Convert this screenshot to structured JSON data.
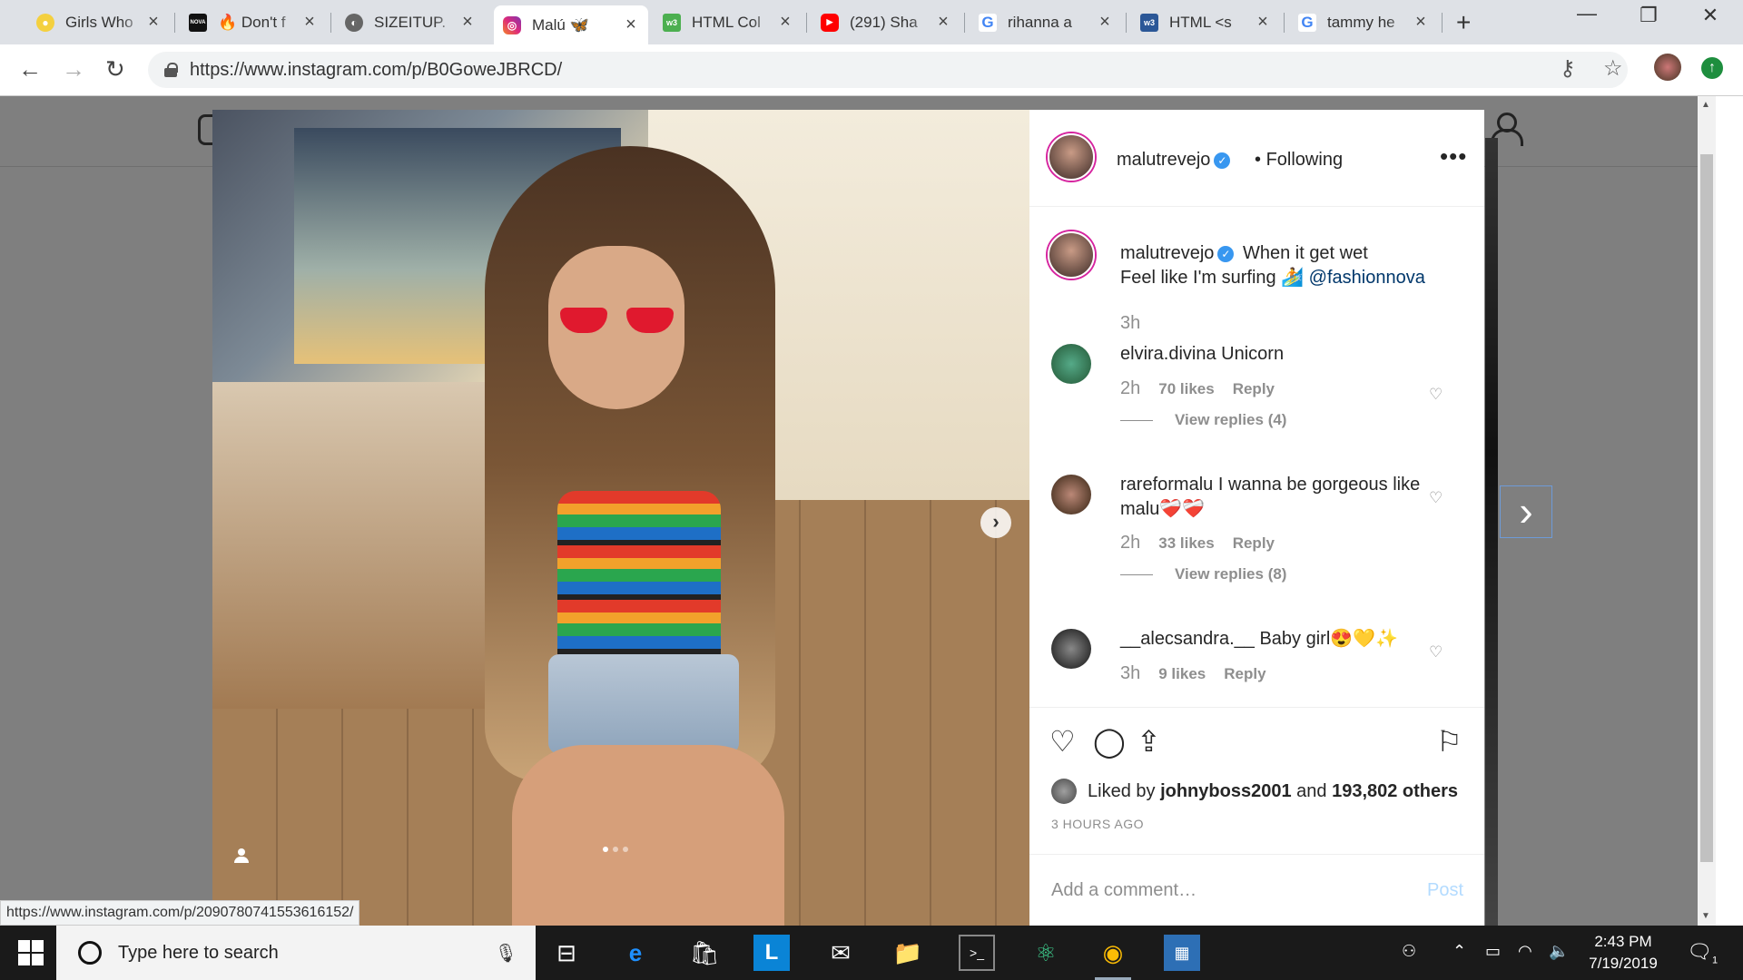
{
  "browser": {
    "tabs": [
      {
        "title": "Girls Who",
        "icon": "lightbulb-icon",
        "color": "#f4d03f",
        "active": false
      },
      {
        "title": "🔥 Don't f",
        "icon": "nova-icon",
        "color": "#111111",
        "active": false
      },
      {
        "title": "SIZEITUP.",
        "icon": "globe-icon",
        "color": "#555555",
        "active": false
      },
      {
        "title": "Malú 🦋",
        "icon": "instagram-icon",
        "color": "#d6249f",
        "active": true
      },
      {
        "title": "HTML Col",
        "icon": "w3-icon",
        "color": "#4caf50",
        "active": false
      },
      {
        "title": "(291) Sha",
        "icon": "youtube-icon",
        "color": "#ff0000",
        "active": false
      },
      {
        "title": "rihanna a",
        "icon": "google-icon",
        "color": "#4285f4",
        "active": false
      },
      {
        "title": "HTML <s",
        "icon": "w3schools-icon",
        "color": "#2b5797",
        "active": false
      },
      {
        "title": "tammy he",
        "icon": "google-icon",
        "color": "#4285f4",
        "active": false
      }
    ],
    "new_tab": "+",
    "url": "https://www.instagram.com/p/B0GoweJBRCD/",
    "status_url": "https://www.instagram.com/p/2090780741553616152/"
  },
  "post": {
    "username": "malutrevejo",
    "following": "Following",
    "separator": "•",
    "more": "•••",
    "caption_line1": "When it get wet",
    "caption_line2": "Feel like I'm surfing 🏄",
    "caption_mention": "@fashionnova",
    "caption_time": "3h",
    "comments": [
      {
        "user": "elvira.divina",
        "text": "Unicorn",
        "time": "2h",
        "likes": "70 likes",
        "reply": "Reply",
        "view_replies": "View replies (4)"
      },
      {
        "user": "rareformalu",
        "text": "I wanna be gorgeous like malu❤️‍🩹❤️‍🩹",
        "time": "2h",
        "likes": "33 likes",
        "reply": "Reply",
        "view_replies": "View replies (8)"
      },
      {
        "user": "__alecsandra.__",
        "text": "Baby girl😍💛✨",
        "time": "3h",
        "likes": "9 likes",
        "reply": "Reply"
      }
    ],
    "liked_prefix": "Liked by",
    "liked_user": "johnyboss2001",
    "liked_and": "and",
    "liked_others": "193,802 others",
    "posted_ago": "3 HOURS AGO",
    "comment_placeholder": "Add a comment…",
    "post_button": "Post"
  },
  "taskbar": {
    "search_placeholder": "Type here to search",
    "time": "2:43 PM",
    "date": "7/19/2019",
    "notifications": "1"
  }
}
